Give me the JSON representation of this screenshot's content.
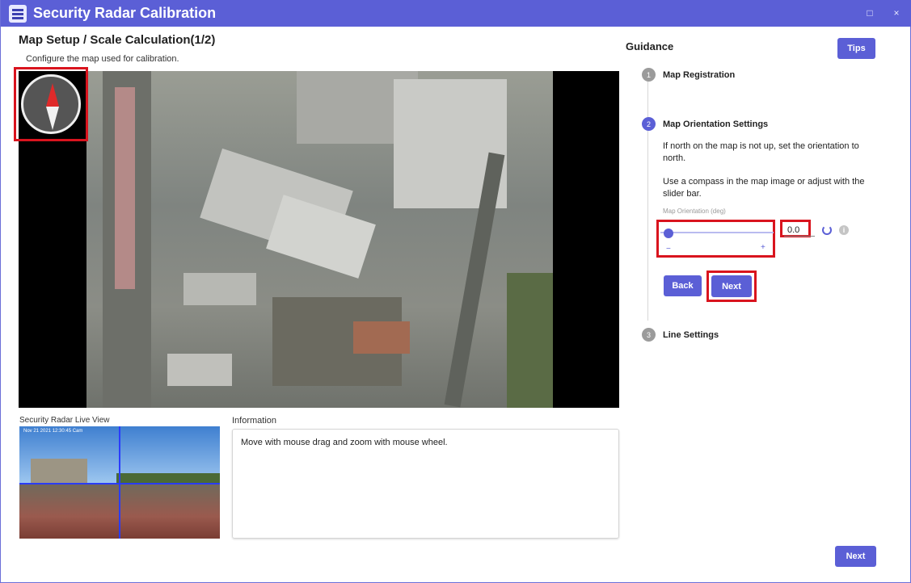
{
  "window": {
    "title": "Security Radar Calibration",
    "maximize_glyph": "□",
    "close_glyph": "×"
  },
  "left": {
    "page_title": "Map Setup / Scale Calculation(1/2)",
    "page_subtitle": "Configure the map used for calibration.",
    "live_view_label": "Security Radar Live View",
    "live_stamp": "Nov 21 2021 12:30:45 Cam",
    "information_label": "Information",
    "information_text": "Move with mouse drag and zoom with mouse wheel."
  },
  "guidance": {
    "title": "Guidance",
    "tips_label": "Tips",
    "steps": [
      {
        "number": "1",
        "label": "Map Registration",
        "state": "done"
      },
      {
        "number": "2",
        "label": "Map Orientation Settings",
        "state": "active"
      },
      {
        "number": "3",
        "label": "Line Settings",
        "state": "pending"
      }
    ],
    "step2_text_1": "If north on the map is not up, set the orientation to north.",
    "step2_text_2": "Use a compass in the map image or adjust with the slider bar.",
    "slider_caption": "Map Orientation (deg)",
    "orientation_value": "0.0",
    "slider_level": 0,
    "slider_minus": "−",
    "slider_plus": "+",
    "info_glyph": "i",
    "back_label": "Back",
    "next_label": "Next"
  },
  "footer": {
    "next_label": "Next"
  },
  "colors": {
    "accent": "#5b5fd6",
    "highlight": "#d9141e"
  },
  "icons": [
    "app-icon",
    "compass-icon",
    "reset-icon",
    "info-icon"
  ]
}
